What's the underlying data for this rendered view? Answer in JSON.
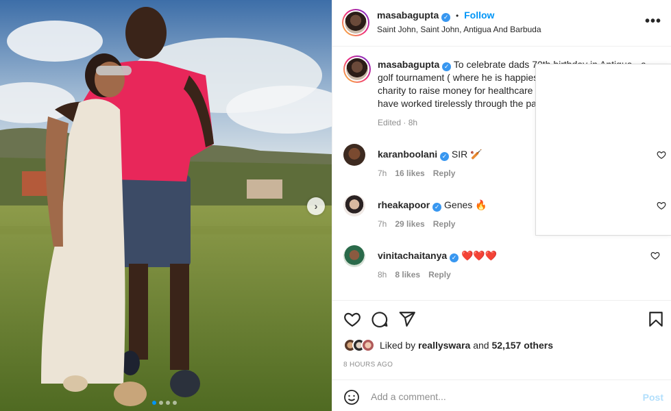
{
  "post": {
    "username": "masabagupta",
    "follow_label": "Follow",
    "separator": "•",
    "location": "Saint John, Saint John, Antigua And Barbuda",
    "more_label": "•••",
    "caption": "To celebrate dads 70th birthday in Antigua - a golf tournament ( where he is happiest after a cricket field ) for charity to raise money for healthcare workers in the region who have worked tirelessly through the pandemic. 💜 🧿",
    "caption_meta": "Edited · 8h",
    "image_dots": 4,
    "active_dot": 0
  },
  "comments": [
    {
      "user": "karanboolani",
      "text": "SIR 🏏",
      "time": "7h",
      "likes": "16 likes",
      "reply": "Reply"
    },
    {
      "user": "rheakapoor",
      "text": "Genes 🔥",
      "time": "7h",
      "likes": "29 likes",
      "reply": "Reply"
    },
    {
      "user": "vinitachaitanya",
      "text": "❤️❤️❤️",
      "time": "8h",
      "likes": "8 likes",
      "reply": "Reply"
    }
  ],
  "likes": {
    "prefix": "Liked by",
    "user": "reallyswara",
    "middle": "and",
    "others": "52,157 others"
  },
  "timestamp": "8 HOURS AGO",
  "add_comment": {
    "placeholder": "Add a comment...",
    "post_label": "Post"
  },
  "colors": {
    "accent": "#0095f6",
    "verified": "#3897f0",
    "muted": "#8e8e8e",
    "post_disabled": "#b2dffc"
  },
  "icons": [
    "more-icon",
    "verified-icon",
    "heart-icon",
    "comment-icon",
    "share-icon",
    "bookmark-icon",
    "emoji-icon",
    "chevron-right-icon"
  ]
}
